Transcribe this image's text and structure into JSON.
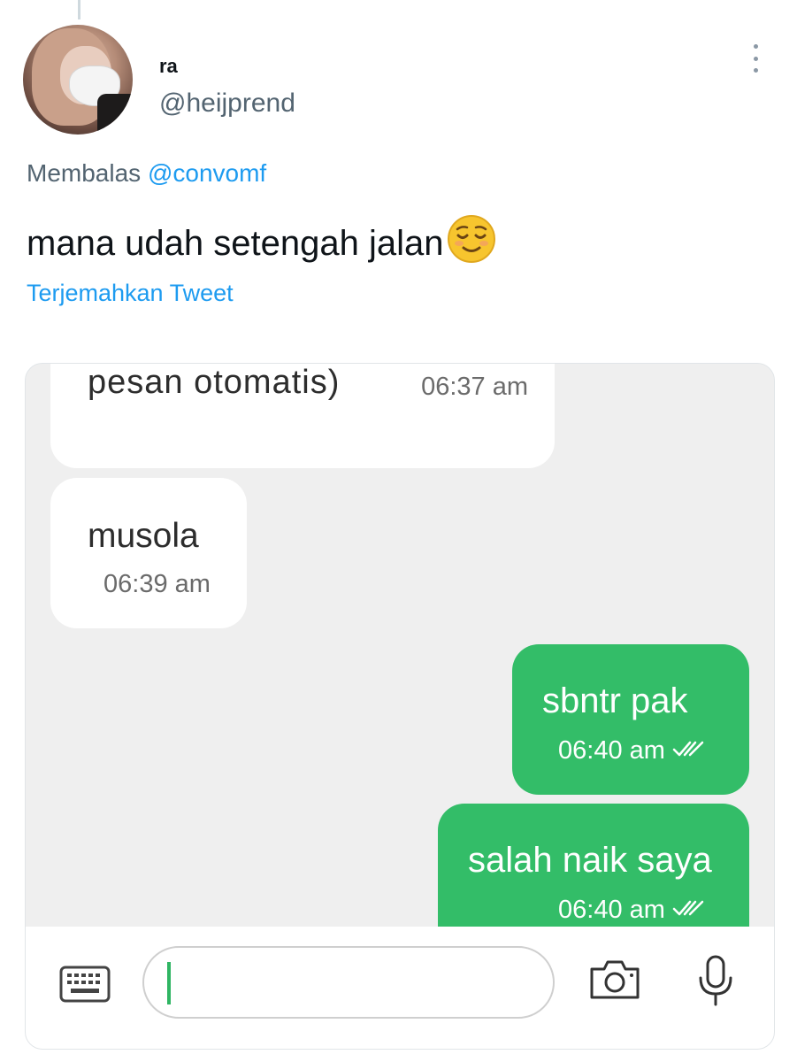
{
  "tweet": {
    "display_name": "ra",
    "handle": "@heijprend",
    "reply_prefix": "Membalas",
    "reply_mention": "@convomf",
    "text": "mana udah setengah jalan",
    "emoji": "relieved-face",
    "translate_label": "Terjemahkan Tweet"
  },
  "chat": {
    "messages": [
      {
        "direction": "incoming",
        "text": "pesan otomatis)",
        "time": "06:37 am"
      },
      {
        "direction": "incoming",
        "text": "musola",
        "time": "06:39 am"
      },
      {
        "direction": "outgoing",
        "text": "sbntr pak",
        "time": "06:40 am",
        "status": "read-double-check"
      },
      {
        "direction": "outgoing",
        "text": "salah naik saya",
        "time": "06:40 am",
        "status": "read-double-check"
      }
    ],
    "input_value": "",
    "icons": [
      "keyboard-icon",
      "camera-icon",
      "microphone-icon"
    ]
  },
  "colors": {
    "outgoing_bubble": "#33bd68",
    "incoming_bubble": "#ffffff",
    "link": "#1d9bf0",
    "chat_background": "#efefef"
  }
}
